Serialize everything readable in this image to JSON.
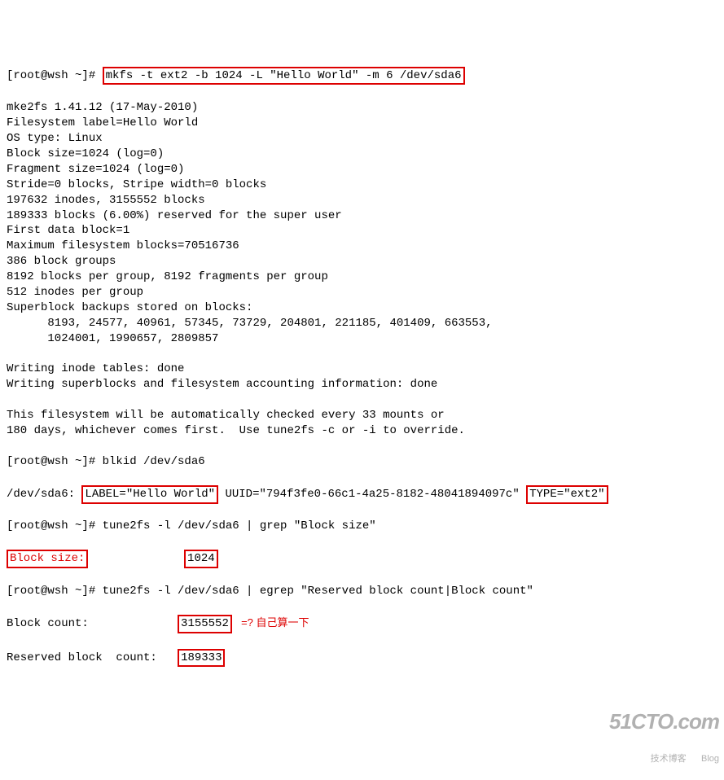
{
  "prompt1_pre": "[root@wsh ~]# ",
  "cmd1": "mkfs -t ext2 -b 1024 -L \"Hello World\" -m 6 /dev/sda6",
  "out": [
    "mke2fs 1.41.12 (17-May-2010)",
    "Filesystem label=Hello World",
    "OS type: Linux",
    "Block size=1024 (log=0)",
    "Fragment size=1024 (log=0)",
    "Stride=0 blocks, Stripe width=0 blocks",
    "197632 inodes, 3155552 blocks",
    "189333 blocks (6.00%) reserved for the super user",
    "First data block=1",
    "Maximum filesystem blocks=70516736",
    "386 block groups",
    "8192 blocks per group, 8192 fragments per group",
    "512 inodes per group",
    "Superblock backups stored on blocks:",
    "      8193, 24577, 40961, 57345, 73729, 204801, 221185, 401409, 663553,",
    "      1024001, 1990657, 2809857",
    "",
    "Writing inode tables: done",
    "Writing superblocks and filesystem accounting information: done",
    "",
    "This filesystem will be automatically checked every 33 mounts or",
    "180 days, whichever comes first.  Use tune2fs -c or -i to override."
  ],
  "prompt2": "[root@wsh ~]# blkid /dev/sda6",
  "blk_pre": "/dev/sda6: ",
  "blk_label": "LABEL=\"Hello World\"",
  "blk_mid": " UUID=\"794f3fe0-66c1-4a25-8182-48041894097c\" ",
  "blk_type": "TYPE=\"ext2\"",
  "prompt3": "[root@wsh ~]# tune2fs -l /dev/sda6 | grep \"Block size\"",
  "bs_label": "Block size:",
  "bs_pad": "              ",
  "bs_val": "1024",
  "prompt4_pre": "[root@wsh ~]# tune2fs -l /dev/sda6 | egrep \"Reserved block count|Block coun",
  "prompt4_tail": "t\"",
  "bc_label": "Block count:",
  "bc_pad": "             ",
  "bc_val": "3155552",
  "annot": "  =? 自己算一下",
  "rb_label": "Reserved block  count:",
  "rb_pad": "   ",
  "rb_val": "189333",
  "wm_big": "51CTO.com",
  "wm_small": "技术博客      Blog"
}
